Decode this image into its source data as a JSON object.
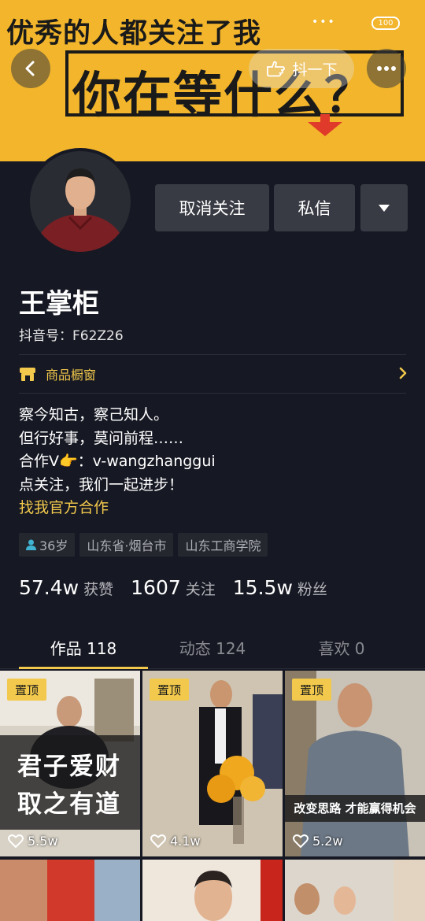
{
  "banner": {
    "top_text": "优秀的人都关注了我",
    "main_text": "你在等什么？"
  },
  "status": {
    "battery": "100"
  },
  "nav": {
    "shake_label": "抖一下"
  },
  "actions": {
    "unfollow_label": "取消关注",
    "message_label": "私信"
  },
  "profile": {
    "name": "王掌柜",
    "douyin_id": "抖音号：F62Z26",
    "shop_label": "商品橱窗",
    "bio_lines": [
      "察今知古，察己知人。",
      "但行好事，莫问前程……",
      "合作V👉：v-wangzhanggui",
      "点关注，我们一起进步！"
    ],
    "bio_link": "找我官方合作",
    "tags": [
      "36岁",
      "山东省·烟台市",
      "山东工商学院"
    ]
  },
  "stats": {
    "likes_num": "57.4w",
    "likes_label": "获赞",
    "following_num": "1607",
    "following_label": "关注",
    "fans_num": "15.5w",
    "fans_label": "粉丝"
  },
  "tabs": [
    {
      "label": "作品 118"
    },
    {
      "label": "动态 124"
    },
    {
      "label": "喜欢 0"
    }
  ],
  "videos": [
    {
      "pin": "置顶",
      "likes": "5.5w",
      "caption_line1": "君子爱财",
      "caption_line2": "取之有道"
    },
    {
      "pin": "置顶",
      "likes": "4.1w"
    },
    {
      "pin": "置顶",
      "likes": "5.2w",
      "caption": "改变思路 才能赢得机会"
    }
  ],
  "colors": {
    "background": "#161823",
    "banner": "#f2b52b",
    "accent": "#f2c94c",
    "button": "#393b44"
  }
}
